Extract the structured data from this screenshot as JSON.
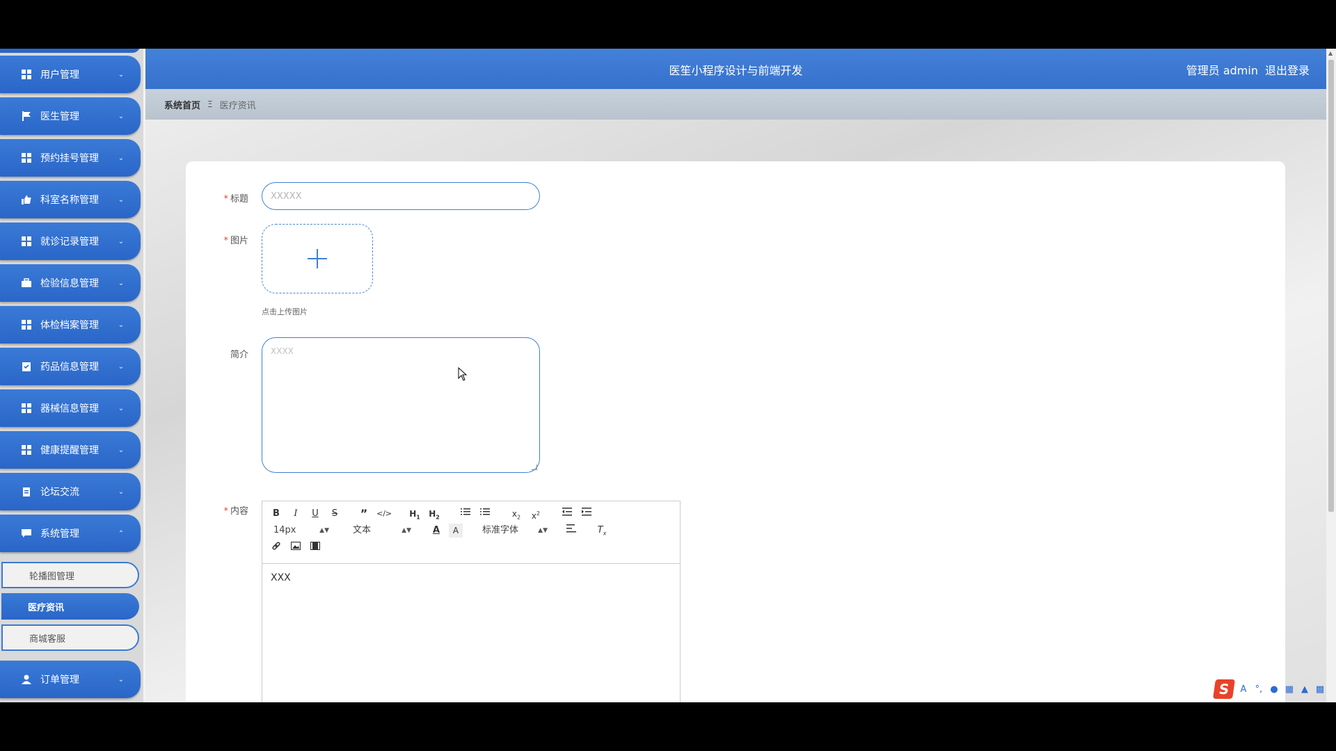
{
  "header": {
    "title": "医笙小程序设计与前端开发",
    "user_role": "管理员 admin",
    "logout": "退出登录"
  },
  "breadcrumb": {
    "home": "系统首页",
    "separator": "Ξ",
    "current": "医疗资讯"
  },
  "sidebar": {
    "items": [
      {
        "label": "用户管理",
        "icon": "grid-icon"
      },
      {
        "label": "医生管理",
        "icon": "flag-icon"
      },
      {
        "label": "预约挂号管理",
        "icon": "grid-icon"
      },
      {
        "label": "科室名称管理",
        "icon": "thumbs-up-icon"
      },
      {
        "label": "就诊记录管理",
        "icon": "grid-icon"
      },
      {
        "label": "检验信息管理",
        "icon": "briefcase-icon"
      },
      {
        "label": "体检档案管理",
        "icon": "grid-icon"
      },
      {
        "label": "药品信息管理",
        "icon": "clipboard-check-icon"
      },
      {
        "label": "器械信息管理",
        "icon": "grid-icon"
      },
      {
        "label": "健康提醒管理",
        "icon": "grid-icon"
      },
      {
        "label": "论坛交流",
        "icon": "clipboard-icon"
      },
      {
        "label": "系统管理",
        "icon": "chat-icon"
      }
    ],
    "sub_items": [
      {
        "label": "轮播图管理",
        "active": false
      },
      {
        "label": "医疗资讯",
        "active": true
      },
      {
        "label": "商城客服",
        "active": false
      }
    ],
    "last_item": {
      "label": "订单管理",
      "icon": "user-icon"
    }
  },
  "form": {
    "title_label": "标题",
    "title_placeholder": "XXXXX",
    "image_label": "图片",
    "upload_tip": "点击上传图片",
    "intro_label": "简介",
    "intro_placeholder": "XXXX",
    "content_label": "内容",
    "content_value": "XXX",
    "required_mark": "*"
  },
  "editor": {
    "font_size": "14px",
    "block_type": "文本",
    "font_family": "标准字体"
  },
  "colors": {
    "primary": "#2a66c8",
    "header": "#3d79d2",
    "required": "#e3473c"
  }
}
